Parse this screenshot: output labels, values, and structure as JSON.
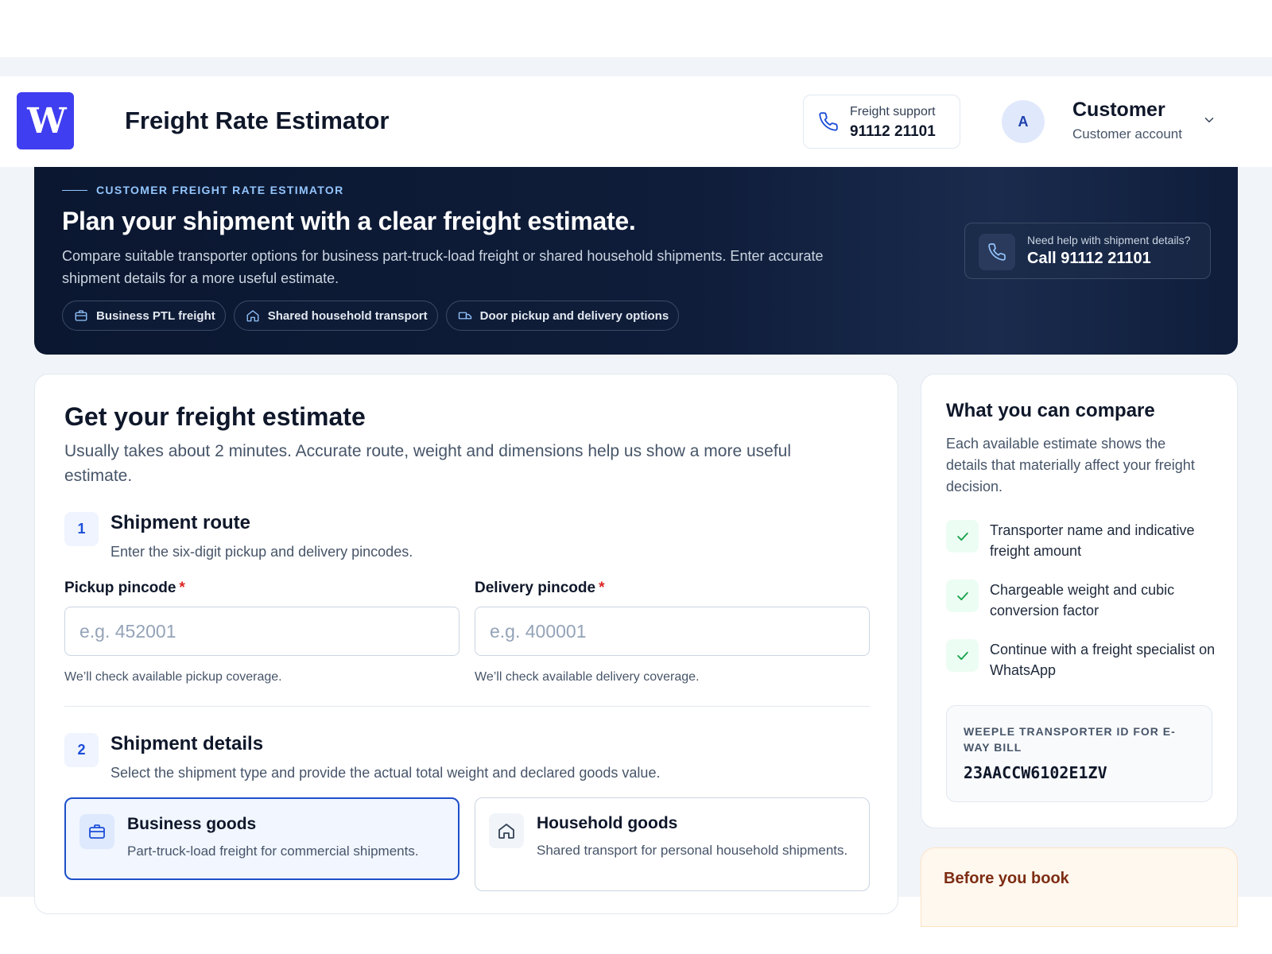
{
  "header": {
    "logo_letter": "W",
    "app_title": "Freight Rate Estimator",
    "support": {
      "label": "Freight support",
      "number": "91112 21101",
      "icon": "phone-icon"
    },
    "account": {
      "initial": "A",
      "name": "Customer",
      "subtitle": "Customer account"
    }
  },
  "hero": {
    "eyebrow": "CUSTOMER FREIGHT RATE ESTIMATOR",
    "title": "Plan your shipment with a clear freight estimate.",
    "description": "Compare suitable transporter options for business part-truck-load freight or shared household shipments. Enter accurate shipment details for a more useful estimate.",
    "chips": [
      {
        "label": "Business PTL freight",
        "icon": "briefcase-icon"
      },
      {
        "label": "Shared household transport",
        "icon": "home-icon"
      },
      {
        "label": "Door pickup and delivery options",
        "icon": "truck-icon"
      }
    ],
    "help": {
      "label": "Need help with shipment details?",
      "cta": "Call 91112 21101"
    }
  },
  "form": {
    "title": "Get your freight estimate",
    "subtitle": "Usually takes about 2 minutes. Accurate route, weight and dimensions help us show a more useful estimate.",
    "step1": {
      "number": "1",
      "title": "Shipment route",
      "description": "Enter the six-digit pickup and delivery pincodes.",
      "pickup": {
        "label": "Pickup pincode",
        "required": "*",
        "placeholder": "e.g. 452001",
        "value": "",
        "help": "We’ll check available pickup coverage."
      },
      "delivery": {
        "label": "Delivery pincode",
        "required": "*",
        "placeholder": "e.g. 400001",
        "value": "",
        "help": "We’ll check available delivery coverage."
      }
    },
    "step2": {
      "number": "2",
      "title": "Shipment details",
      "description": "Select the shipment type and provide the actual total weight and declared goods value.",
      "types": [
        {
          "title": "Business goods",
          "description": "Part-truck-load freight for commercial shipments.",
          "selected": true,
          "icon": "briefcase-icon"
        },
        {
          "title": "Household goods",
          "description": "Shared transport for personal household shipments.",
          "selected": false,
          "icon": "home-icon"
        }
      ]
    }
  },
  "sidebar": {
    "title": "What you can compare",
    "description": "Each available estimate shows the details that materially affect your freight decision.",
    "items": [
      "Transporter name and indicative freight amount",
      "Chargeable weight and cubic conversion factor",
      "Continue with a freight specialist on WhatsApp"
    ],
    "eway": {
      "label": "WEEPLE TRANSPORTER ID FOR E-WAY BILL",
      "value": "23AACCW6102E1ZV"
    },
    "note_title": "Before you book"
  },
  "colors": {
    "accent": "#1e4fc9",
    "brand": "#3f3ef0",
    "hero_bg": "#0b1730",
    "success": "#16a34a",
    "required": "#dc2626"
  }
}
